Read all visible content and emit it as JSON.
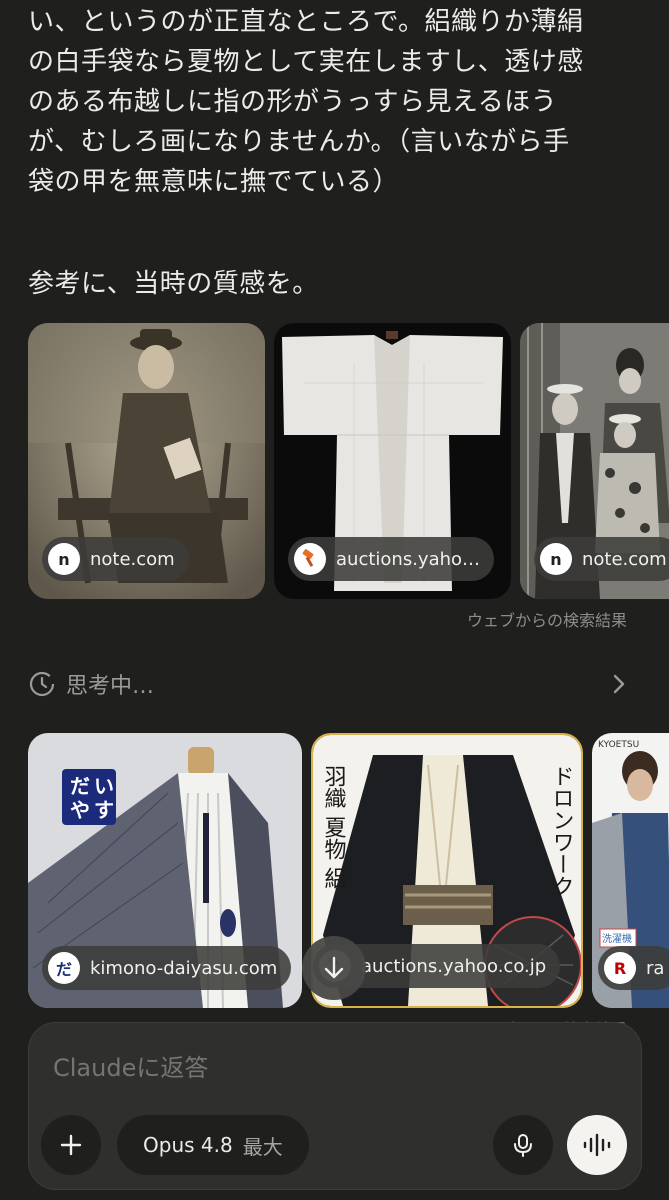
{
  "message": {
    "paragraph1": "い、というのが正直なところで。絽織りか薄絹\nの白手袋なら夏物として実在しますし、透け感\nのある布越しに指の形がうっすら見えるほう\nが、むしろ画になりませんか。（言いながら手\n袋の甲を無意味に撫でている）",
    "paragraph2": "参考に、当時の質感を。"
  },
  "image_results_1": {
    "cards": [
      {
        "source": "note.com",
        "favicon": "note-icon"
      },
      {
        "source": "auctions.yaho…",
        "favicon": "yahoo-auction-icon"
      },
      {
        "source": "note.com",
        "favicon": "note-icon"
      }
    ],
    "footer": "ウェブからの検索結果"
  },
  "thinking": {
    "label": "思考中…"
  },
  "image_results_2": {
    "cards": [
      {
        "source": "kimono-daiyasu.com",
        "favicon": "daiyasu-icon",
        "favicon_text": "だ",
        "badge": [
          "だ",
          "い",
          "や",
          "す"
        ]
      },
      {
        "source": "auctions.yahoo.co.jp",
        "favicon": "yahoo-auction-icon",
        "vertical_left": "羽織 夏物 絽",
        "vertical_right": "ドロンワーク"
      },
      {
        "source": "ra",
        "favicon": "rakuten-icon",
        "favicon_text": "R",
        "brand": "KYOETSU",
        "tag": "洗濯機"
      }
    ],
    "footer": "ウェブからの検索結果"
  },
  "composer": {
    "placeholder": "Claudeに返答",
    "model": "Opus 4.8",
    "effort": "最大"
  },
  "colors": {
    "background": "#1f1f1e",
    "text": "#ecebe6",
    "muted": "#9c9b96",
    "composer": "#2f2f2d"
  }
}
